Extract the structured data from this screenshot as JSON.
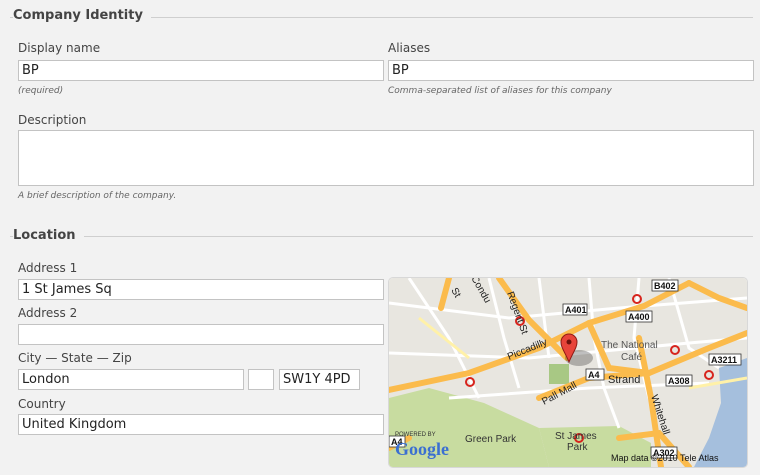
{
  "company_identity": {
    "legend": "Company Identity",
    "display_name": {
      "label": "Display name",
      "value": "BP",
      "hint": "(required)"
    },
    "aliases": {
      "label": "Aliases",
      "value": "BP",
      "hint": "Comma-separated list of aliases for this company"
    },
    "description": {
      "label": "Description",
      "value": "",
      "hint": "A brief description of the company."
    }
  },
  "location": {
    "legend": "Location",
    "address1": {
      "label": "Address 1",
      "value": "1 St James Sq"
    },
    "address2": {
      "label": "Address 2",
      "value": ""
    },
    "city_state_zip_label": "City — State — Zip",
    "city": {
      "value": "London"
    },
    "state": {
      "value": ""
    },
    "zip": {
      "value": "SW1Y 4PD"
    },
    "country": {
      "label": "Country",
      "value": "United Kingdom"
    }
  },
  "map": {
    "labels": {
      "regent_st": "Regent St",
      "piccadilly": "Piccadilly",
      "pall_mall": "Pall Mall",
      "strand": "Strand",
      "whitehall": "Whitehall",
      "national_cafe_1": "The National",
      "national_cafe_2": "Café",
      "green_park": "Green Park",
      "st_james_1": "St James",
      "st_james_2": "Park",
      "st": "St",
      "condu": "Condu"
    },
    "road_badges": [
      "B402",
      "A401",
      "A400",
      "A4",
      "A308",
      "A3211",
      "A4",
      "A302"
    ],
    "powered_by": "POWERED BY",
    "google": "Google",
    "attribution": "Map data ©2010 Tele Atlas",
    "colors": {
      "water": "#a5bfdd",
      "park": "#c8dca0",
      "major_road": "#fbbb4c",
      "land": "#e8e6e0"
    }
  }
}
